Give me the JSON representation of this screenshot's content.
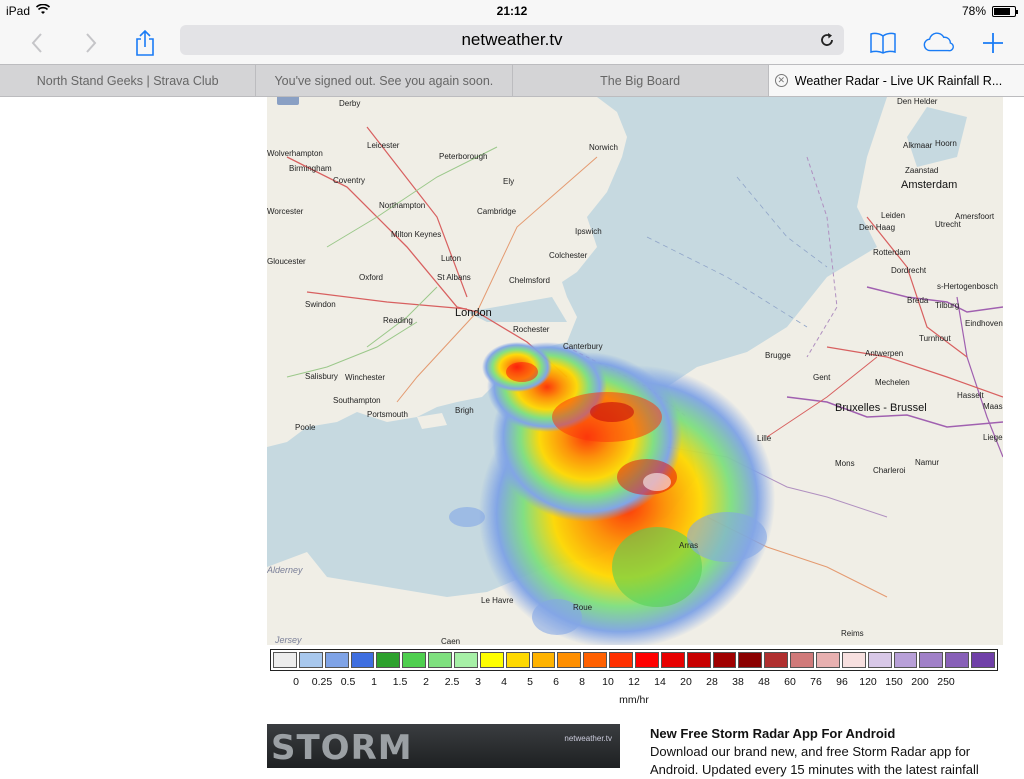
{
  "status": {
    "device": "iPad",
    "time": "21:12",
    "battery": "78%",
    "battery_level": 0.78
  },
  "toolbar": {
    "url": "netweather.tv",
    "icons": [
      "back-icon",
      "forward-icon",
      "share-icon",
      "reload-icon",
      "bookmarks-icon",
      "icloud-tabs-icon",
      "new-tab-icon"
    ]
  },
  "tabs": [
    {
      "label": "North Stand Geeks | Strava Club",
      "active": false
    },
    {
      "label": "You've signed out. See you again soon.",
      "active": false
    },
    {
      "label": "The Big Board",
      "active": false
    },
    {
      "label": "Weather Radar - Live UK Rainfall R...",
      "active": true
    }
  ],
  "map": {
    "places": {
      "derby": "Derby",
      "leicester": "Leicester",
      "peterborough": "Peterborough",
      "norwich": "Norwich",
      "wolverhampton": "Wolverhampton",
      "birmingham": "Birmingham",
      "coventry": "Coventry",
      "ely": "Ely",
      "worcester": "Worcester",
      "northampton": "Northampton",
      "cambridge": "Cambridge",
      "ipswich": "Ipswich",
      "milton_keynes": "Milton Keynes",
      "gloucester": "Gloucester",
      "luton": "Luton",
      "colchester": "Colchester",
      "oxford": "Oxford",
      "st_albans": "St Albans",
      "chelmsford": "Chelmsford",
      "swindon": "Swindon",
      "london": "London",
      "reading": "Reading",
      "rochester": "Rochester",
      "canterbury": "Canterbury",
      "salisbury": "Salisbury",
      "winchester": "Winchester",
      "southampton": "Southampton",
      "portsmouth": "Portsmouth",
      "brighton": "Brigh",
      "poole": "Poole",
      "le_havre": "Le Havre",
      "rouen": "Roue",
      "caen": "Caen",
      "alderney": "Alderney",
      "jersey": "Jersey",
      "den_helder": "Den Helder",
      "alkmaar": "Alkmaar",
      "hoorn": "Hoorn",
      "zaandstad": "Zaanstad",
      "amsterdam": "Amsterdam",
      "leiden": "Leiden",
      "amersfoort": "Amersfoort",
      "den_haag": "Den Haag",
      "utrecht": "Utrecht",
      "rotterdam": "Rotterdam",
      "dordrecht": "Dordrecht",
      "s_hertogenbosch": "s-Hertogenbosch",
      "breda": "Breda",
      "tilburg": "Tilburg",
      "eindhoven": "Eindhoven",
      "turnhout": "Turnhout",
      "brugge": "Brugge",
      "antwerpen": "Antwerpen",
      "gent": "Gent",
      "mechelen": "Mechelen",
      "hasselt": "Hasselt",
      "bruxelles": "Bruxelles - Brussel",
      "lille": "Lille",
      "maas": "Maas",
      "liege": "Liege",
      "mons": "Mons",
      "namur": "Namur",
      "charleroi": "Charleroi",
      "reims": "Reims",
      "arras": "Arras"
    }
  },
  "legend": {
    "colors": [
      "#ededed",
      "#a8c8ee",
      "#7fa3e6",
      "#3f6fe0",
      "#2ea12e",
      "#4fcf4f",
      "#7fe07f",
      "#a7f0a7",
      "#ffff00",
      "#ffd900",
      "#ffb300",
      "#ff8f00",
      "#ff6000",
      "#ff3000",
      "#ff0000",
      "#e80000",
      "#c80000",
      "#a00000",
      "#8b0000",
      "#b03030",
      "#d07a7a",
      "#e8b0b0",
      "#f8e0e0",
      "#d8c8e8",
      "#b8a0d8",
      "#a080c8",
      "#8860b8",
      "#7040a8"
    ],
    "ticks": [
      "0",
      "0.25",
      "0.5",
      "1",
      "1.5",
      "2",
      "2.5",
      "3",
      "4",
      "5",
      "6",
      "8",
      "10",
      "12",
      "14",
      "20",
      "28",
      "38",
      "48",
      "60",
      "76",
      "96",
      "120",
      "150",
      "200",
      "250"
    ],
    "unit": "mm/hr"
  },
  "promo": {
    "image_text": "STORM",
    "logo_text": "netweather.tv",
    "title": "New Free Storm Radar App For Android",
    "body": "Download our brand new, and free Storm Radar app for Android. Updated every 15 minutes with the latest rainfall"
  }
}
